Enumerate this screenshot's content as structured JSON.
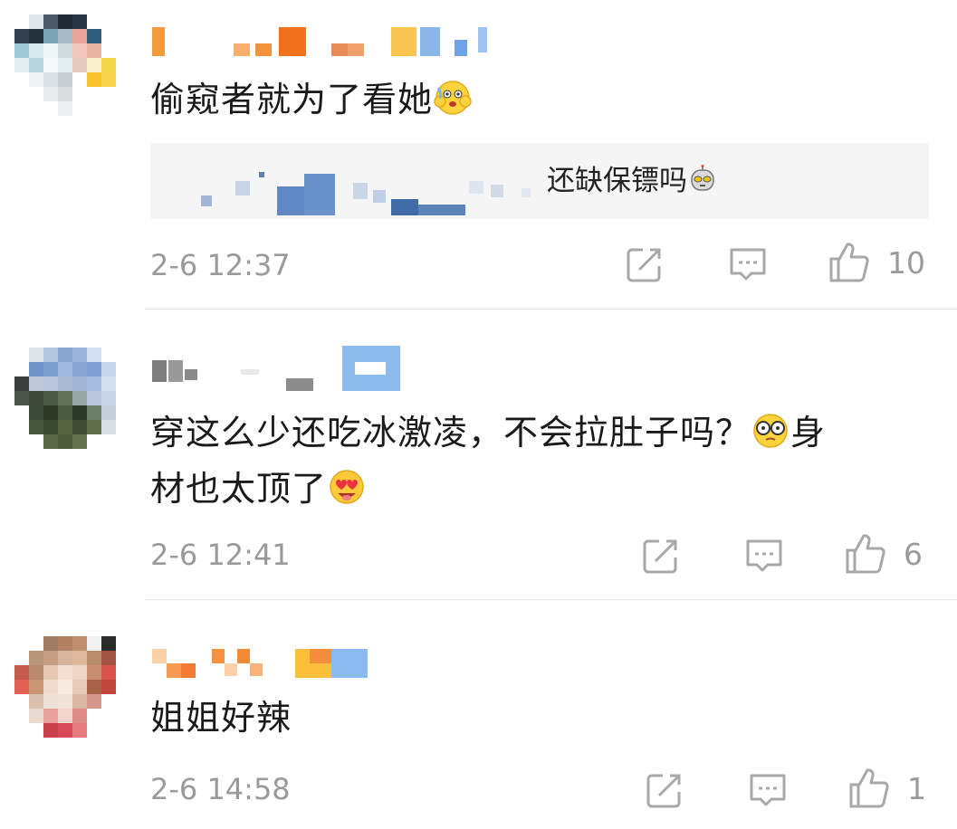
{
  "comments": [
    {
      "text": "偷窥者就为了看她",
      "emoji_after": "scared-emoji",
      "reply": {
        "text": "还缺保镖吗",
        "emoji_after": "robot-emoji"
      },
      "time": "2-6 12:37",
      "likes": "10"
    },
    {
      "text_part1": "穿这么少还吃冰激凌，不会拉肚子吗？",
      "emoji_mid": "glasses-emoji",
      "text_part2": "身",
      "text_line2": "材也太顶了",
      "emoji_after": "heart-eyes-emoji",
      "time": "2-6 12:41",
      "likes": "6"
    },
    {
      "text": "姐姐好辣",
      "time": "2-6 14:58",
      "likes": "1"
    }
  ],
  "icons": {
    "repost": "repost-icon",
    "comment": "comment-icon",
    "like": "thumbs-up-icon"
  },
  "colors": {
    "time": "#9a9a9a",
    "icon": "#a8a8a8",
    "reply_bg": "#f5f5f5"
  }
}
